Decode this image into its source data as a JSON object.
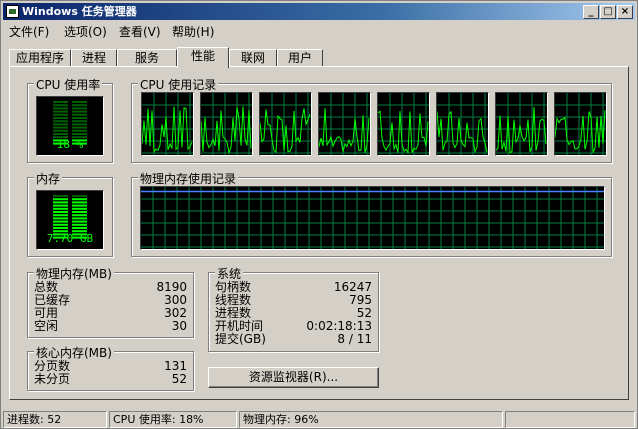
{
  "window": {
    "title": "Windows 任务管理器",
    "controls": [
      "_",
      "□",
      "×"
    ]
  },
  "menu": [
    "文件(F)",
    "选项(O)",
    "查看(V)",
    "帮助(H)"
  ],
  "tabs": [
    "应用程序",
    "进程",
    "服务",
    "性能",
    "联网",
    "用户"
  ],
  "active_tab": 3,
  "cpu_usage": {
    "label": "CPU 使用率",
    "value": "18 %",
    "level": 0.18
  },
  "cpu_history": {
    "label": "CPU 使用记录",
    "cores": 8
  },
  "memory": {
    "label": "内存",
    "value": "7.70 GB",
    "level": 0.96
  },
  "mem_history": {
    "label": "物理内存使用记录",
    "level": 0.96
  },
  "physical_memory": {
    "label": "物理内存(MB)",
    "rows": [
      {
        "k": "总数",
        "v": "8190"
      },
      {
        "k": "已缓存",
        "v": "300"
      },
      {
        "k": "可用",
        "v": "302"
      },
      {
        "k": "空闲",
        "v": "30"
      }
    ]
  },
  "kernel_memory": {
    "label": "核心内存(MB)",
    "rows": [
      {
        "k": "分页数",
        "v": "131"
      },
      {
        "k": "未分页",
        "v": "52"
      }
    ]
  },
  "system": {
    "label": "系统",
    "rows": [
      {
        "k": "句柄数",
        "v": "16247"
      },
      {
        "k": "线程数",
        "v": "795"
      },
      {
        "k": "进程数",
        "v": "52"
      },
      {
        "k": "开机时间",
        "v": "0:02:18:13"
      },
      {
        "k": "提交(GB)",
        "v": "8 / 11"
      }
    ]
  },
  "resource_monitor_button": "资源监视器(R)...",
  "status": {
    "processes": "进程数: 52",
    "cpu": "CPU 使用率: 18%",
    "memory": "物理内存: 96%"
  },
  "colors": {
    "graph_green": "#00ff00",
    "grid": "#008040",
    "mem_line": "#4a7fff"
  }
}
